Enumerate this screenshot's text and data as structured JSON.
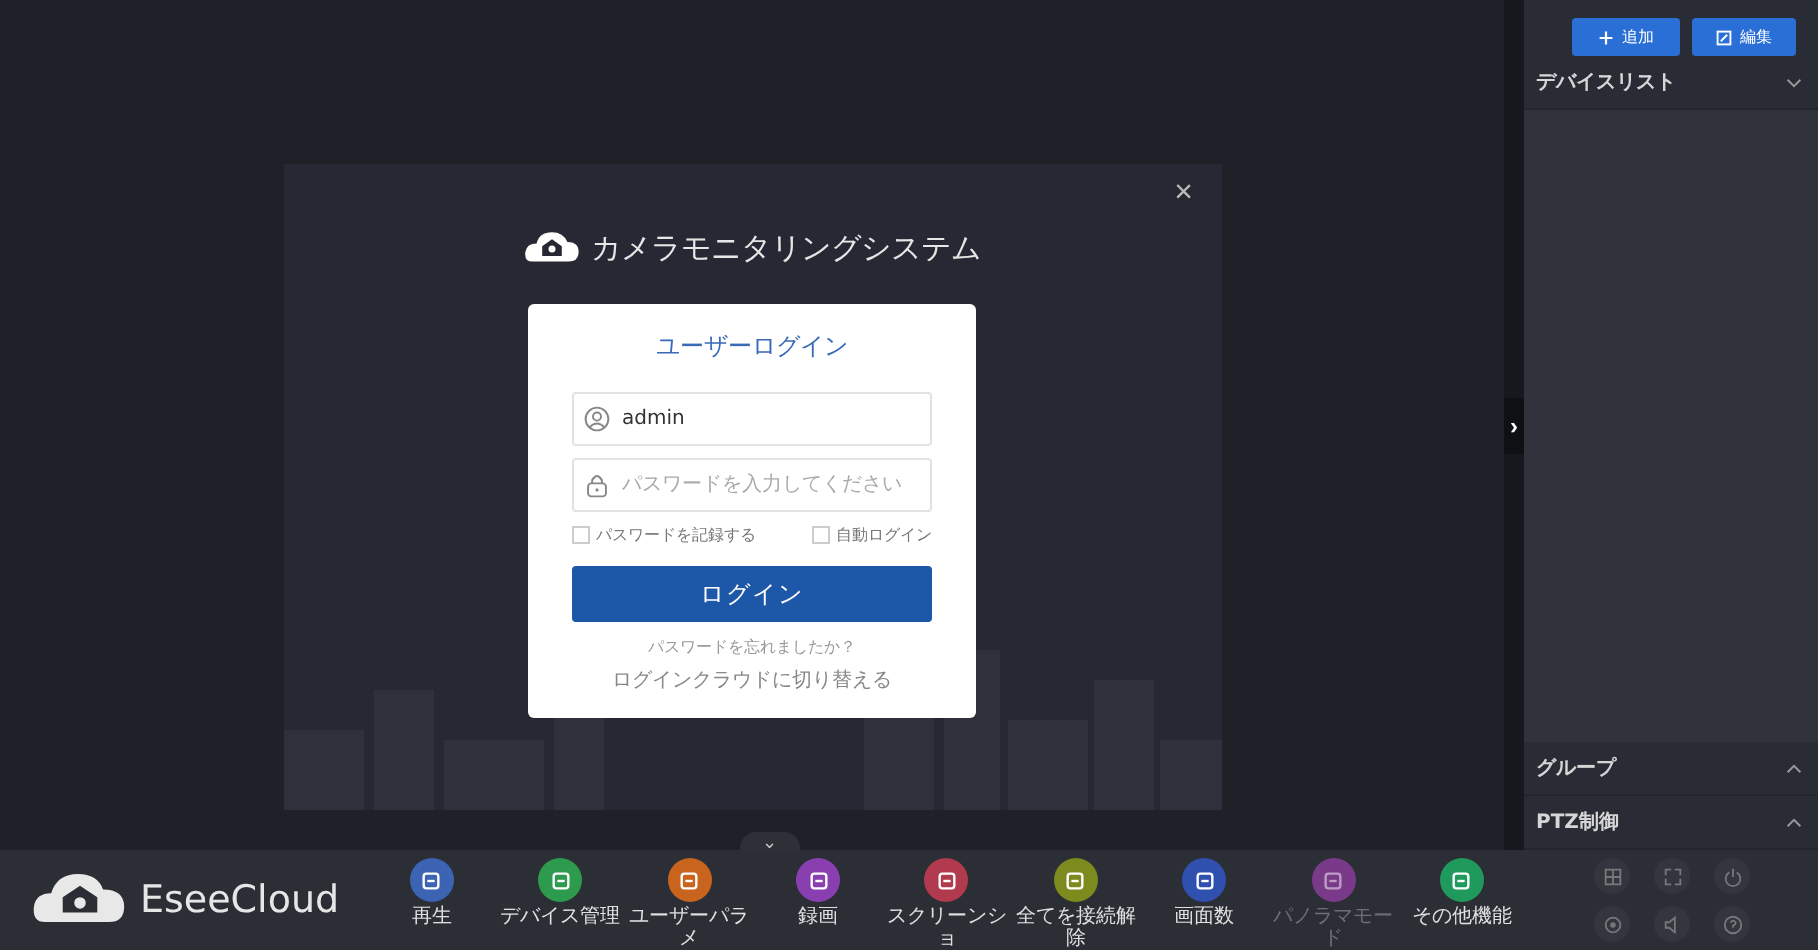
{
  "dialog": {
    "app_title": "カメラモニタリングシステム",
    "close": "×",
    "login": {
      "title": "ユーザーログイン",
      "username": {
        "value": "admin"
      },
      "password": {
        "placeholder": "パスワードを入力してください"
      },
      "options": [
        {
          "label": "パスワードを記録する",
          "checked": false
        },
        {
          "label": "自動ログイン",
          "checked": false
        }
      ],
      "button": "ログイン",
      "forgot": "パスワードを忘れましたか？",
      "switch_link": "ログインクラウドに切り替える"
    }
  },
  "side_toggle": "›",
  "bottom_toggle": "⌄",
  "right_panel": {
    "buttons": [
      {
        "label": "追加",
        "kind": "add"
      },
      {
        "label": "編集",
        "kind": "edit"
      }
    ],
    "sections": [
      {
        "title": "デバイスリスト",
        "expanded": true
      },
      {
        "title": "グループ",
        "expanded": false
      },
      {
        "title": "PTZ制御",
        "expanded": false
      }
    ]
  },
  "toolbar": {
    "brand": "EseeCloud",
    "items": [
      {
        "label": "再生",
        "color": "#3d63b3",
        "disabled": false
      },
      {
        "label": "デバイス管理",
        "color": "#2e9a4e",
        "disabled": false
      },
      {
        "label": "ユーザーパラメ",
        "color": "#c8641e",
        "disabled": false
      },
      {
        "label": "録画",
        "color": "#8a3fb0",
        "disabled": false
      },
      {
        "label": "スクリーンショ",
        "color": "#b23a4e",
        "disabled": false
      },
      {
        "label": "全てを接続解除",
        "color": "#7c8a1e",
        "disabled": false
      },
      {
        "label": "画面数",
        "color": "#3050b0",
        "disabled": false
      },
      {
        "label": "パノラマモード",
        "color": "#7a3a8a",
        "disabled": true
      },
      {
        "label": "その他機能",
        "color": "#1f9a5c",
        "disabled": false
      }
    ]
  }
}
